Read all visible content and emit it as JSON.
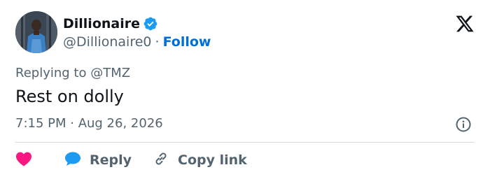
{
  "author": {
    "display_name": "Dillionaire",
    "handle": "@Dillionaire0",
    "follow_label": "Follow",
    "separator": "·"
  },
  "reply_context": {
    "prefix": "Replying to",
    "mention": "@TMZ"
  },
  "tweet": {
    "text": "Rest on dolly",
    "timestamp": "7:15 PM · Aug 26, 2026"
  },
  "actions": {
    "reply_label": "Reply",
    "copy_link_label": "Copy link"
  },
  "icons": {
    "verified": "verified-badge-icon",
    "brand": "x-logo-icon",
    "info": "info-icon",
    "like": "heart-icon",
    "reply": "speech-bubble-icon",
    "copy": "link-icon"
  },
  "colors": {
    "follow": "#006fd6",
    "verified": "#1d9bf0",
    "like": "#f91880",
    "reply": "#1d9bf0",
    "secondary_text": "#536471",
    "primary_text": "#0f1419",
    "divider": "#cfd9de"
  }
}
